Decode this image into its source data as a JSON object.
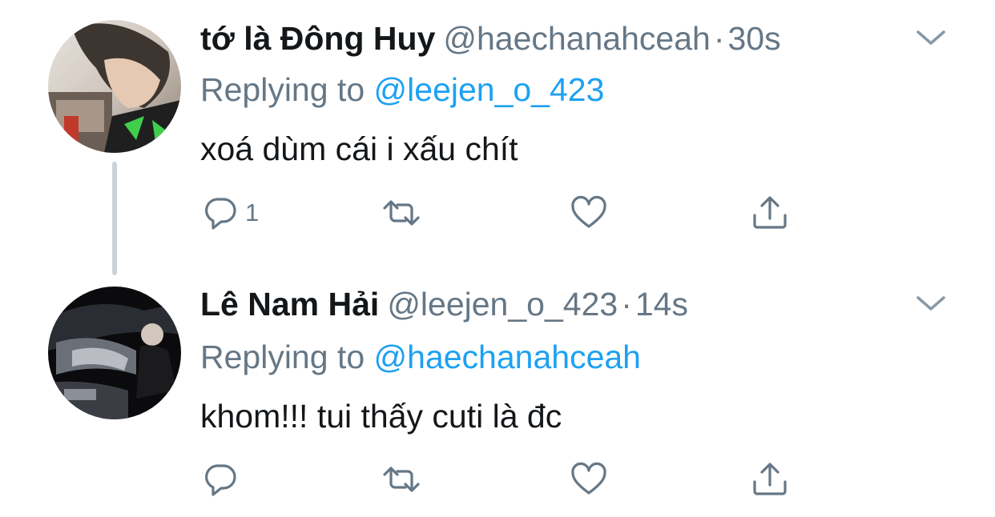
{
  "colors": {
    "text_primary": "#14171a",
    "text_secondary": "#657786",
    "link": "#1da1f2",
    "thread_line": "#c9d3dc"
  },
  "tweets": [
    {
      "display_name": "tớ là Đông Huy",
      "handle": "@haechanahceah",
      "separator": "·",
      "time": "30s",
      "reply_prefix": "Replying to",
      "reply_to": "@leejen_o_423",
      "text": "xoá dùm cái i xấu chít",
      "reply_count": "1",
      "icons": {
        "menu": "chevron-down-icon",
        "reply": "comment-bubble-icon",
        "retweet": "retweet-icon",
        "like": "heart-icon",
        "share": "share-icon"
      }
    },
    {
      "display_name": "Lê Nam Hải",
      "handle": "@leejen_o_423",
      "separator": "·",
      "time": "14s",
      "reply_prefix": "Replying to",
      "reply_to": "@haechanahceah",
      "text": "khom!!! tui thấy cuti là đc",
      "reply_count": "",
      "icons": {
        "menu": "chevron-down-icon",
        "reply": "comment-bubble-icon",
        "retweet": "retweet-icon",
        "like": "heart-icon",
        "share": "share-icon"
      }
    }
  ]
}
